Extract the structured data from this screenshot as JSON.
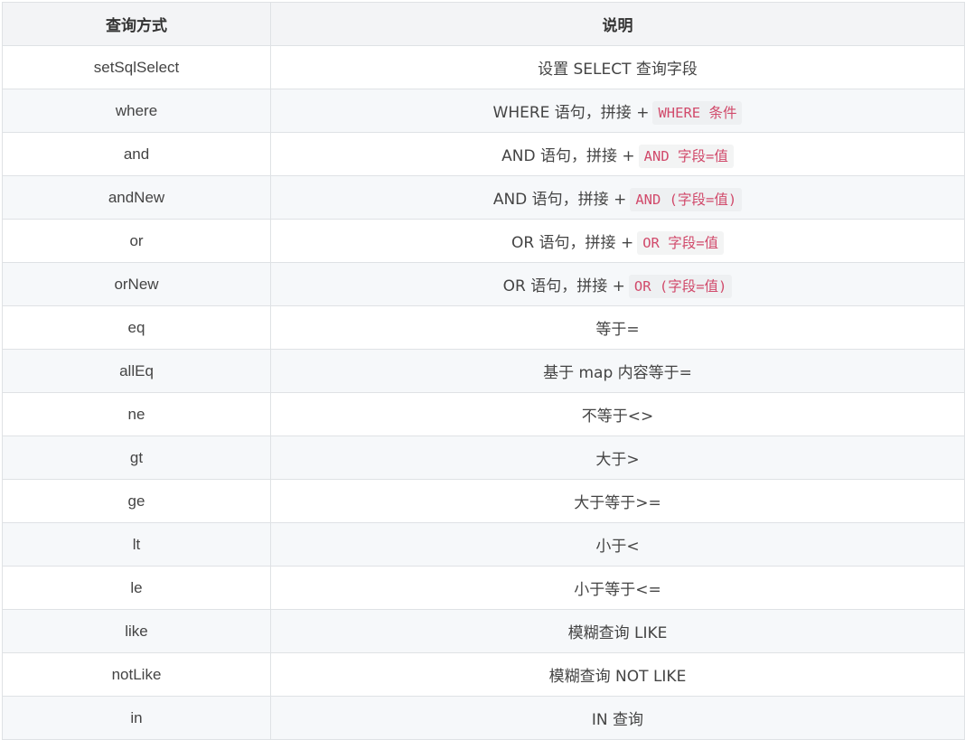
{
  "table": {
    "headers": [
      "查询方式",
      "说明"
    ],
    "rows": [
      {
        "method": "setSqlSelect",
        "desc": "设置 SELECT 查询字段",
        "code": ""
      },
      {
        "method": "where",
        "desc": "WHERE 语句，拼接 +",
        "code": "WHERE 条件"
      },
      {
        "method": "and",
        "desc": "AND 语句，拼接 +",
        "code": "AND 字段=值"
      },
      {
        "method": "andNew",
        "desc": "AND 语句，拼接 +",
        "code": "AND (字段=值)"
      },
      {
        "method": "or",
        "desc": "OR 语句，拼接 +",
        "code": "OR 字段=值"
      },
      {
        "method": "orNew",
        "desc": "OR 语句，拼接 +",
        "code": "OR (字段=值)"
      },
      {
        "method": "eq",
        "desc": "等于=",
        "code": ""
      },
      {
        "method": "allEq",
        "desc": "基于 map 内容等于=",
        "code": ""
      },
      {
        "method": "ne",
        "desc": "不等于<>",
        "code": ""
      },
      {
        "method": "gt",
        "desc": "大于>",
        "code": ""
      },
      {
        "method": "ge",
        "desc": "大于等于>=",
        "code": ""
      },
      {
        "method": "lt",
        "desc": "小于<",
        "code": ""
      },
      {
        "method": "le",
        "desc": "小于等于<=",
        "code": ""
      },
      {
        "method": "like",
        "desc": "模糊查询 LIKE",
        "code": ""
      },
      {
        "method": "notLike",
        "desc": "模糊查询 NOT LIKE",
        "code": ""
      },
      {
        "method": "in",
        "desc": "IN 查询",
        "code": ""
      }
    ]
  }
}
